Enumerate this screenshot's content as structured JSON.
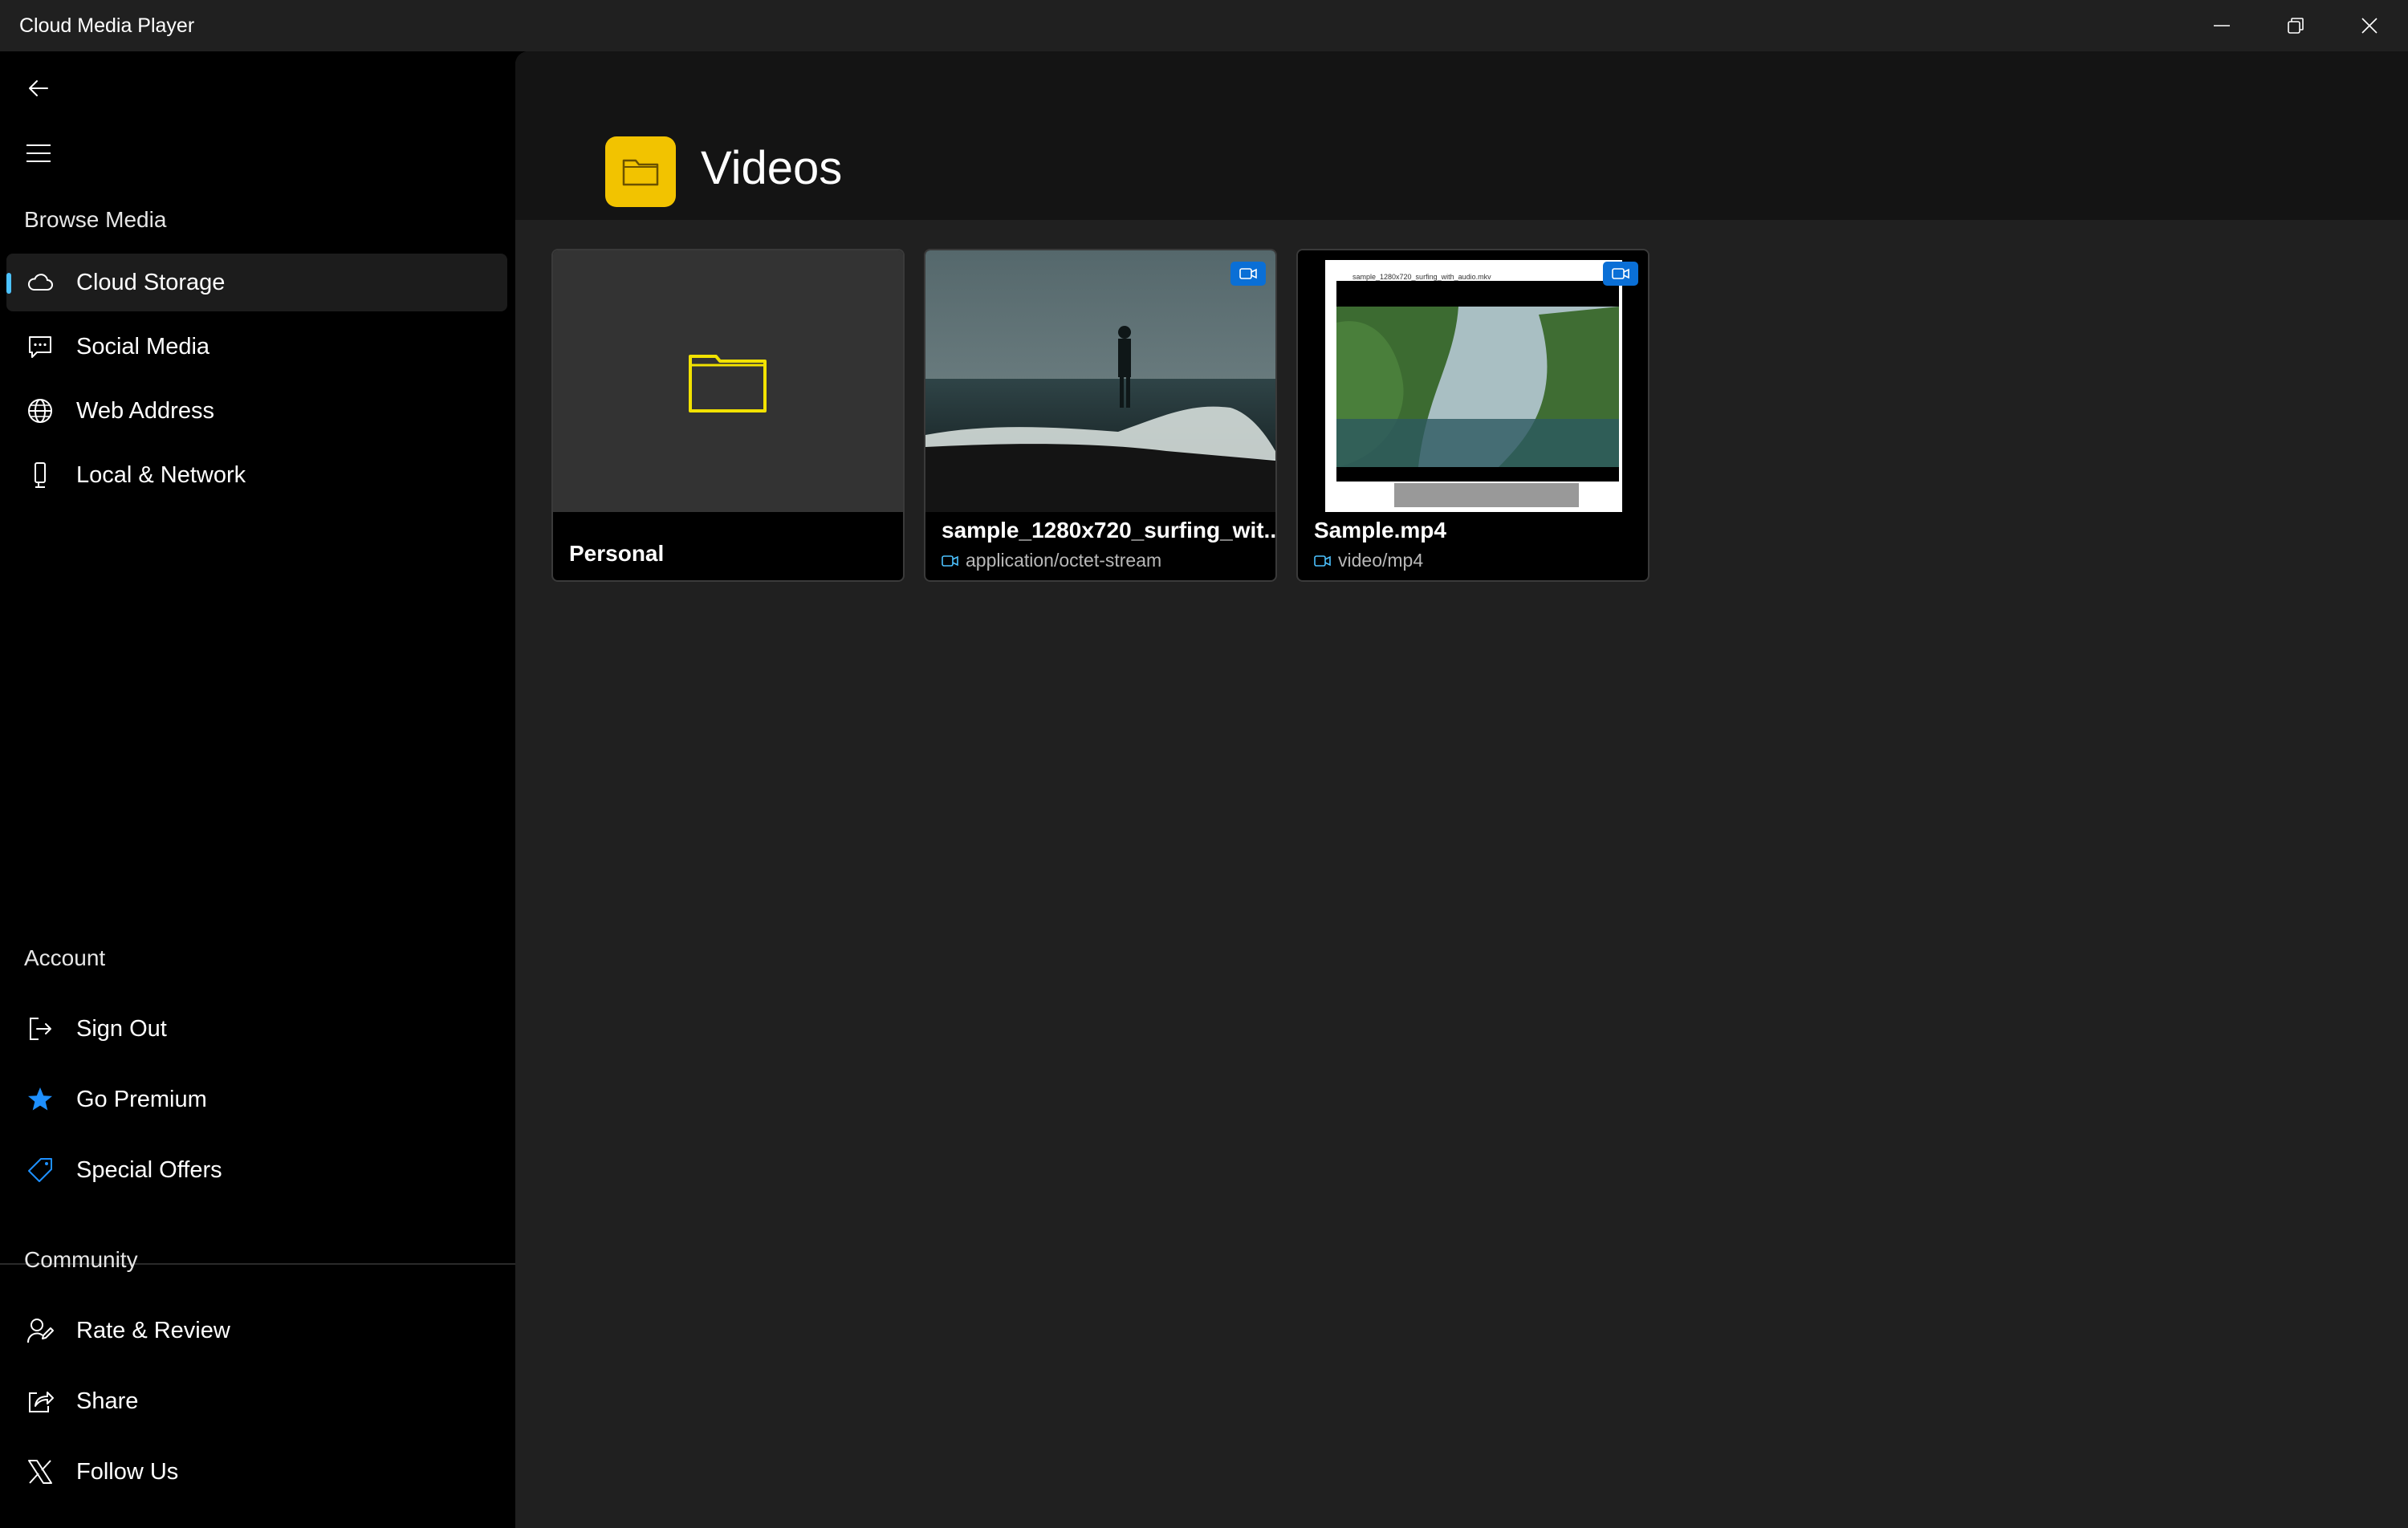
{
  "window": {
    "title": "Cloud Media Player",
    "controls": [
      "minimize-icon",
      "restore-icon",
      "close-icon"
    ]
  },
  "sidebar": {
    "back_icon": "back-arrow-icon",
    "menu_icon": "hamburger-icon",
    "browse_header": "Browse Media",
    "browse_items": [
      {
        "label": "Cloud Storage",
        "icon": "cloud-icon",
        "selected": true
      },
      {
        "label": "Social Media",
        "icon": "chat-icon"
      },
      {
        "label": "Web Address",
        "icon": "globe-icon"
      },
      {
        "label": "Local & Network",
        "icon": "phone-icon"
      }
    ],
    "account_header": "Account",
    "account_items": [
      {
        "label": "Sign Out",
        "icon": "sign-out-icon"
      },
      {
        "label": "Go Premium",
        "icon": "star-icon"
      },
      {
        "label": "Special Offers",
        "icon": "tag-icon"
      }
    ],
    "community_header": "Community",
    "community_items": [
      {
        "label": "Rate & Review",
        "icon": "rate-icon"
      },
      {
        "label": "Share",
        "icon": "share-icon"
      },
      {
        "label": "Follow Us",
        "icon": "x-logo-icon"
      }
    ]
  },
  "main": {
    "title": "Videos",
    "items": [
      {
        "type": "folder",
        "title": "Personal"
      },
      {
        "type": "video",
        "title": "sample_1280x720_surfing_wit...",
        "mime": "application/octet-stream"
      },
      {
        "type": "video",
        "title": "Sample.mp4",
        "mime": "video/mp4",
        "thumb_caption": "sample_1280x720_surfing_with_audio.mkv"
      }
    ]
  },
  "colors": {
    "accent": "#4cc2ff",
    "folder_yellow": "#f2c300",
    "video_badge": "#0a6fd6",
    "star_blue": "#1e90ff"
  }
}
